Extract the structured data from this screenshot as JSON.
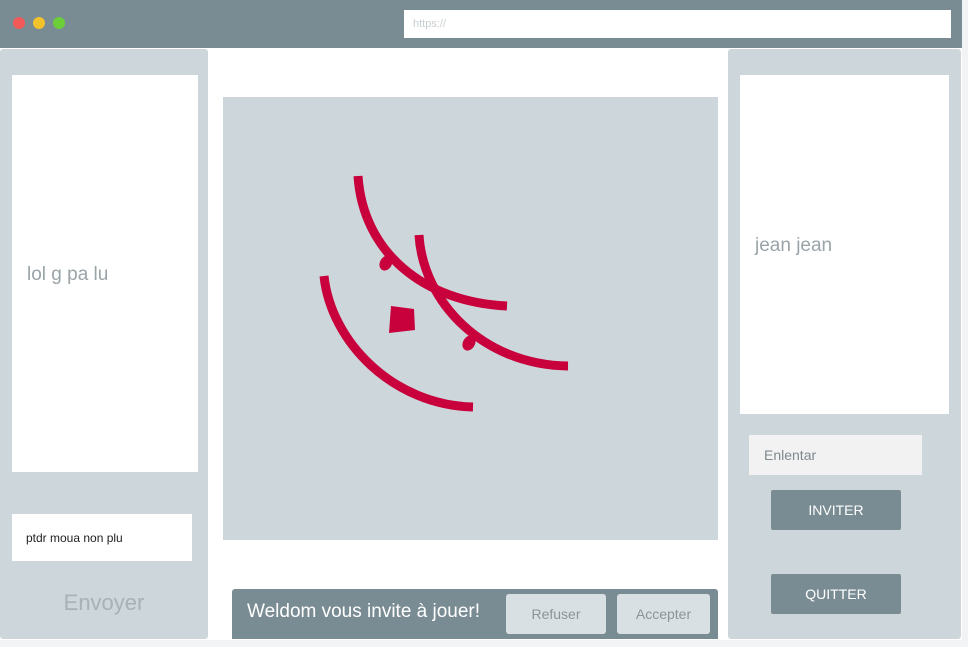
{
  "browser": {
    "url_placeholder": "https://"
  },
  "chat": {
    "message": "lol g pa lu",
    "input_value": "ptdr moua non plu",
    "send_label": "Envoyer"
  },
  "players": {
    "list": [
      "jean jean"
    ],
    "invite_placeholder": "Enlentar",
    "invite_label": "INVITER",
    "quit_label": "QUITTER"
  },
  "invitation": {
    "message": "Weldom vous invite à jouer!",
    "refuse_label": "Refuser",
    "accept_label": "Accepter"
  },
  "colors": {
    "accent": "#7a8c93",
    "panel": "#cdd6da",
    "stroke": "#c8003c"
  }
}
